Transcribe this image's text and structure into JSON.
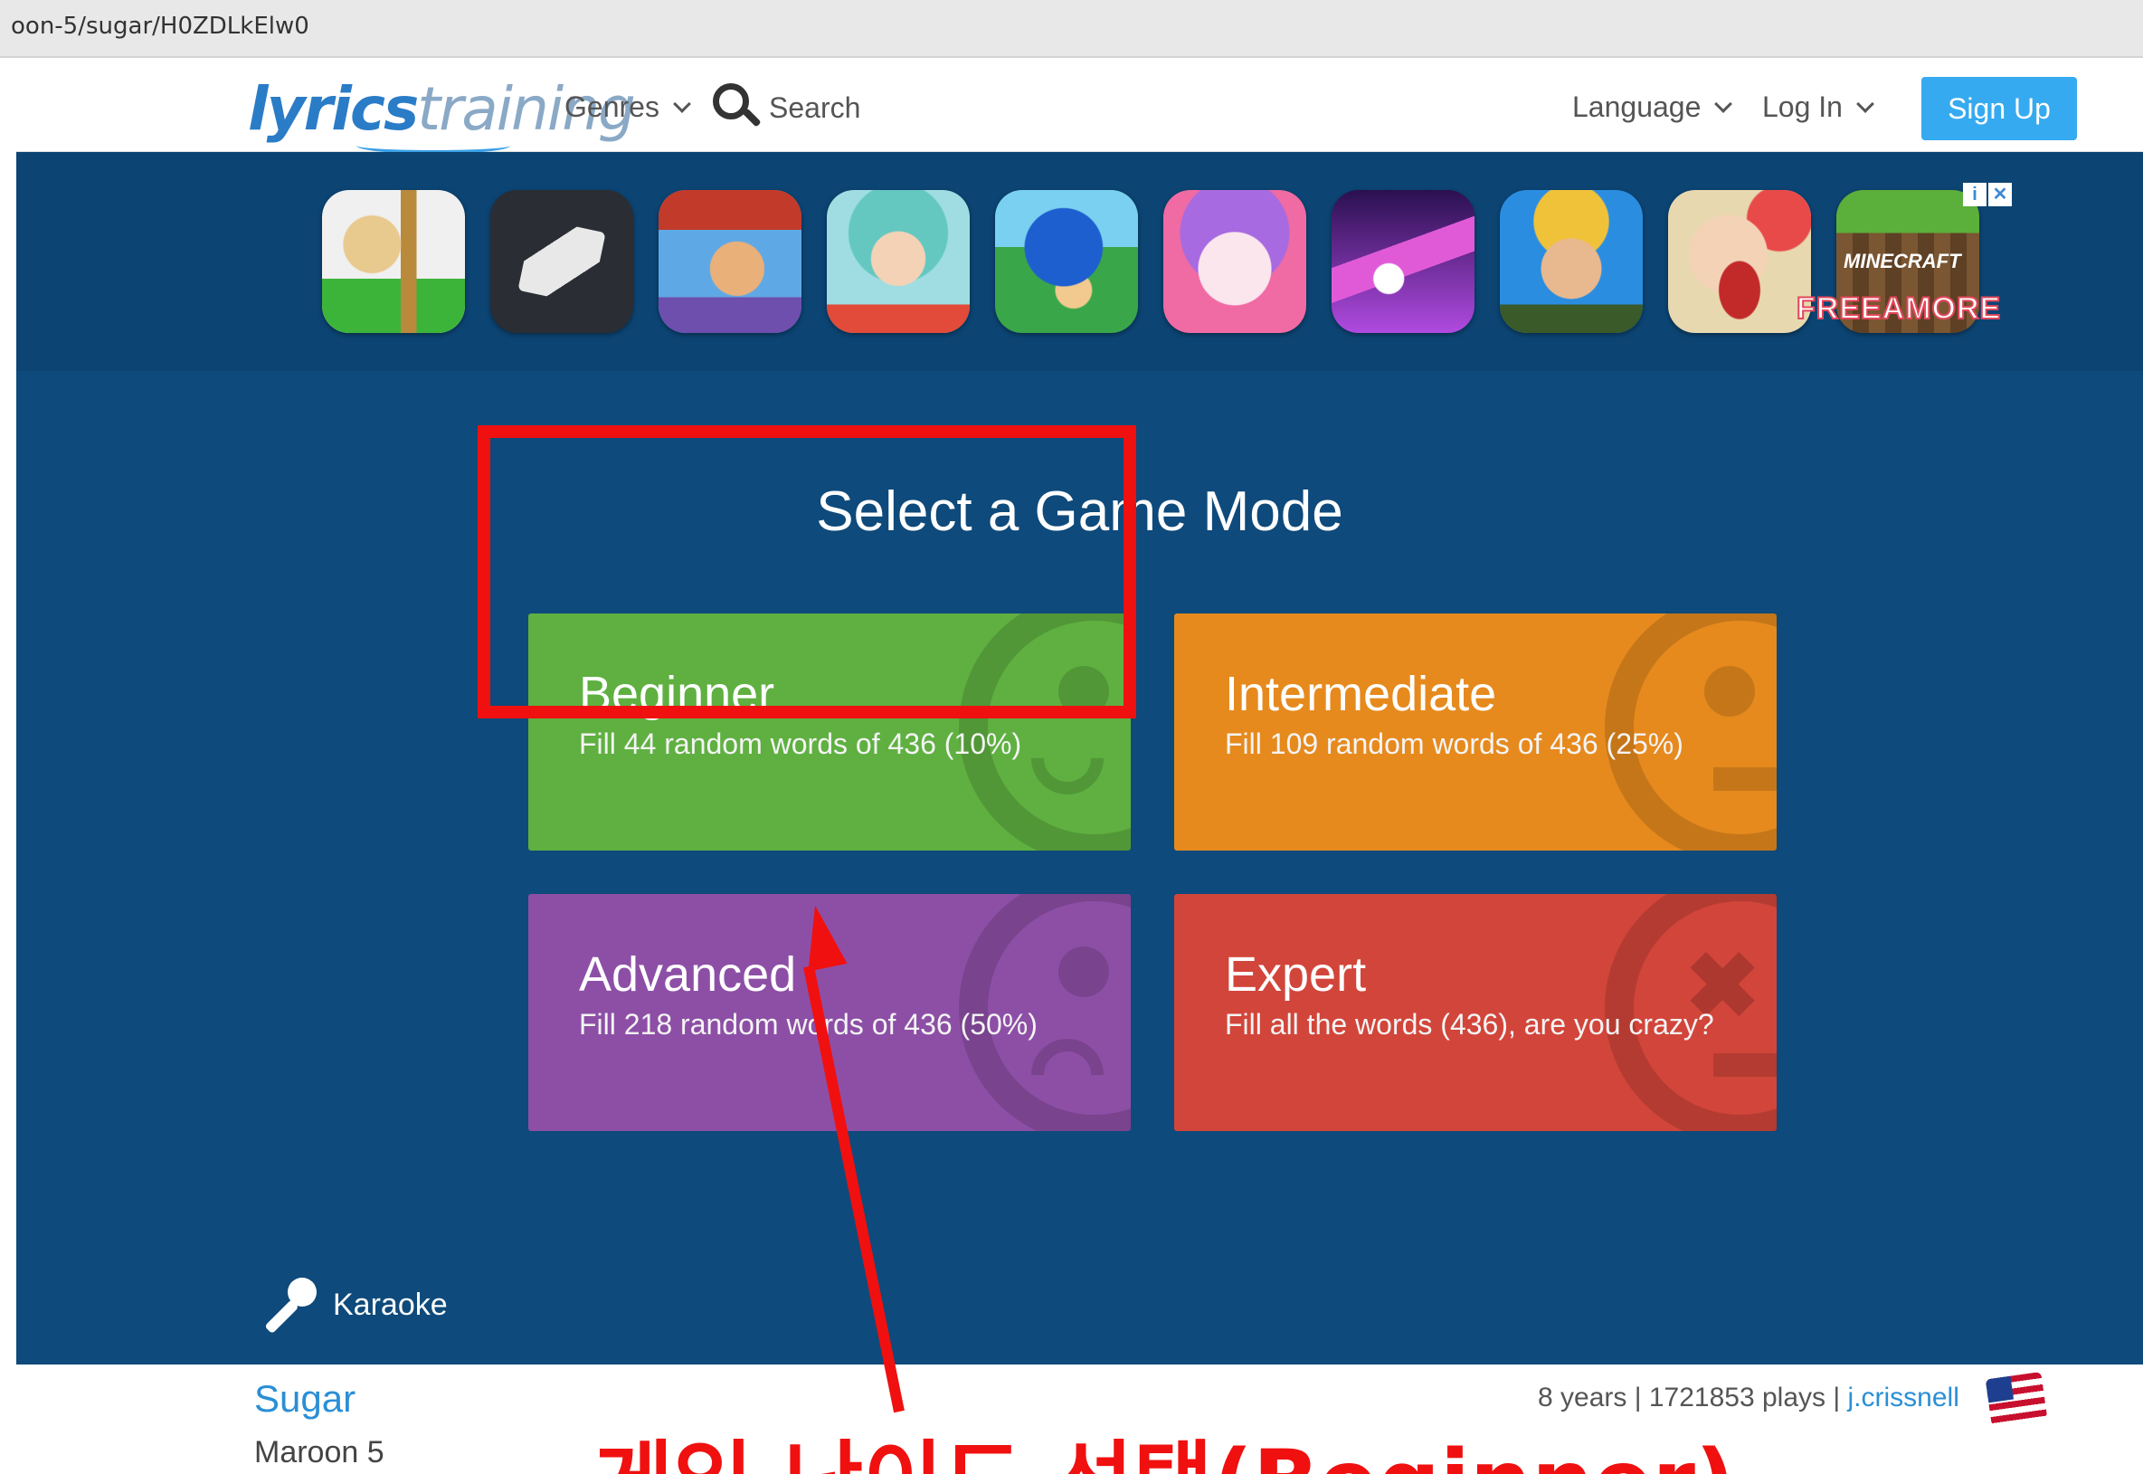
{
  "browser": {
    "url": "oon-5/sugar/H0ZDLkElw0"
  },
  "header": {
    "logo_part1": "lyrics",
    "logo_part2": "training",
    "genres": "Genres",
    "search": "Search",
    "language": "Language",
    "login": "Log In",
    "signup": "Sign Up"
  },
  "ad": {
    "brand": "FREEAMORE",
    "badge_info": "i",
    "badge_close": "✕",
    "apps": [
      "Baldi's Basics",
      "Roblox",
      "Subway Surfers",
      "Toca Life",
      "Sonic Dash",
      "My Talking Angela 2",
      "Tiles Hop",
      "Fortnite",
      "Fruit Ninja",
      "Minecraft"
    ]
  },
  "main": {
    "title": "Select a Game Mode",
    "modes": [
      {
        "name": "Beginner",
        "desc": "Fill 44 random words of 436 (10%)",
        "color": "#5fb041"
      },
      {
        "name": "Intermediate",
        "desc": "Fill 109 random words of 436 (25%)",
        "color": "#e68a1e"
      },
      {
        "name": "Advanced",
        "desc": "Fill 218 random words of 436 (50%)",
        "color": "#8d4fa6"
      },
      {
        "name": "Expert",
        "desc": "Fill all the words (436), are you crazy?",
        "color": "#d2453a"
      }
    ],
    "karaoke": "Karaoke"
  },
  "song": {
    "title": "Sugar",
    "artist": "Maroon 5",
    "age": "8 years",
    "plays": "1721853 plays",
    "uploader": "j.crissnell"
  },
  "annotation": {
    "caption": "게임 난이도 선택(Beginner)",
    "color": "#f01010"
  }
}
